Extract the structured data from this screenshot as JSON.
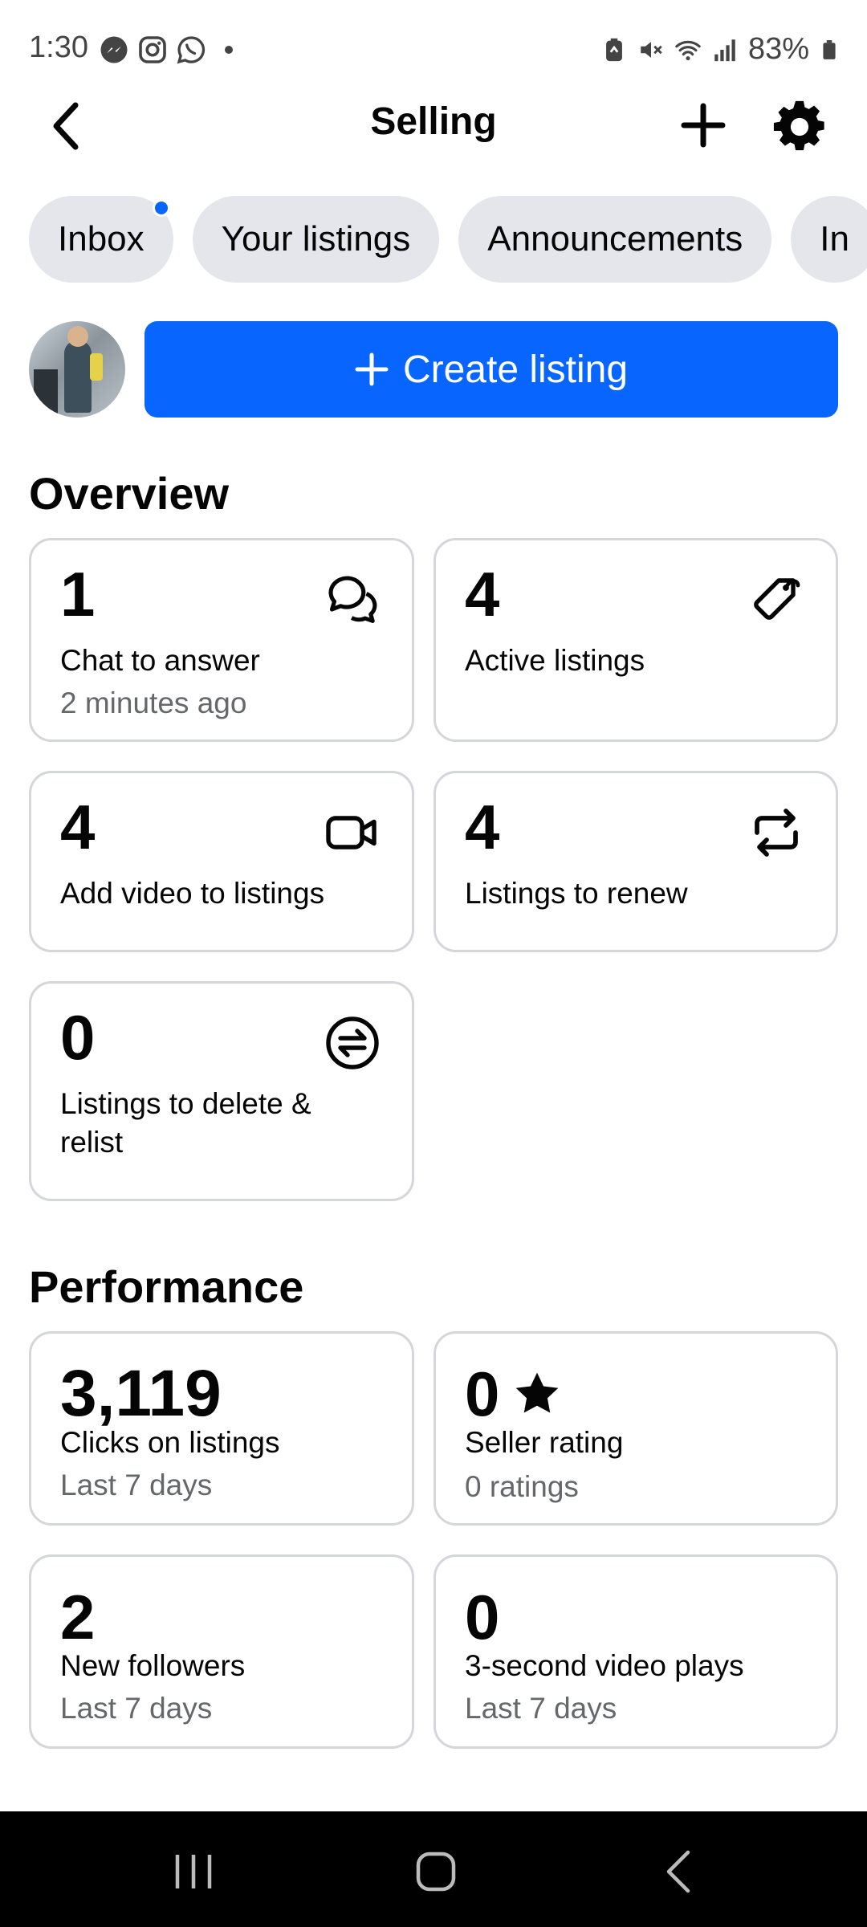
{
  "status_bar": {
    "time": "1:30",
    "battery": "83%",
    "app_icons": [
      "messenger-icon",
      "instagram-icon",
      "whatsapp-icon"
    ],
    "system_icons": [
      "battery-saver-icon",
      "mute-icon",
      "wifi-icon",
      "signal-icon",
      "battery-icon"
    ]
  },
  "header": {
    "title": "Selling",
    "back_icon": "chevron-left-icon",
    "add_icon": "plus-icon",
    "settings_icon": "gear-icon"
  },
  "tabs": [
    {
      "label": "Inbox",
      "has_dot": true
    },
    {
      "label": "Your listings"
    },
    {
      "label": "Announcements"
    },
    {
      "label": "In"
    }
  ],
  "create": {
    "label": "Create listing",
    "accent": "#0866ff"
  },
  "overview": {
    "title": "Overview",
    "cards": [
      {
        "value": "1",
        "label": "Chat to answer",
        "sub": "2 minutes ago",
        "icon": "chat-bubbles-icon"
      },
      {
        "value": "4",
        "label": "Active listings",
        "icon": "tag-icon"
      },
      {
        "value": "4",
        "label": "Add video to listings",
        "icon": "video-camera-icon"
      },
      {
        "value": "4",
        "label": "Listings to renew",
        "icon": "renew-icon"
      },
      {
        "value": "0",
        "label": "Listings to delete & relist",
        "icon": "swap-circle-icon"
      }
    ]
  },
  "performance": {
    "title": "Performance",
    "cards": [
      {
        "value": "3,119",
        "label": "Clicks on listings",
        "sub": "Last 7 days"
      },
      {
        "value": "0",
        "label": "Seller rating",
        "sub": "0 ratings",
        "icon": "star-icon"
      },
      {
        "value": "2",
        "label": "New followers",
        "sub": "Last 7 days"
      },
      {
        "value": "0",
        "label": "3-second video plays",
        "sub": "Last 7 days"
      }
    ]
  },
  "nav": {
    "recents_icon": "recents-icon",
    "home_icon": "home-icon",
    "back_icon": "back-icon"
  }
}
